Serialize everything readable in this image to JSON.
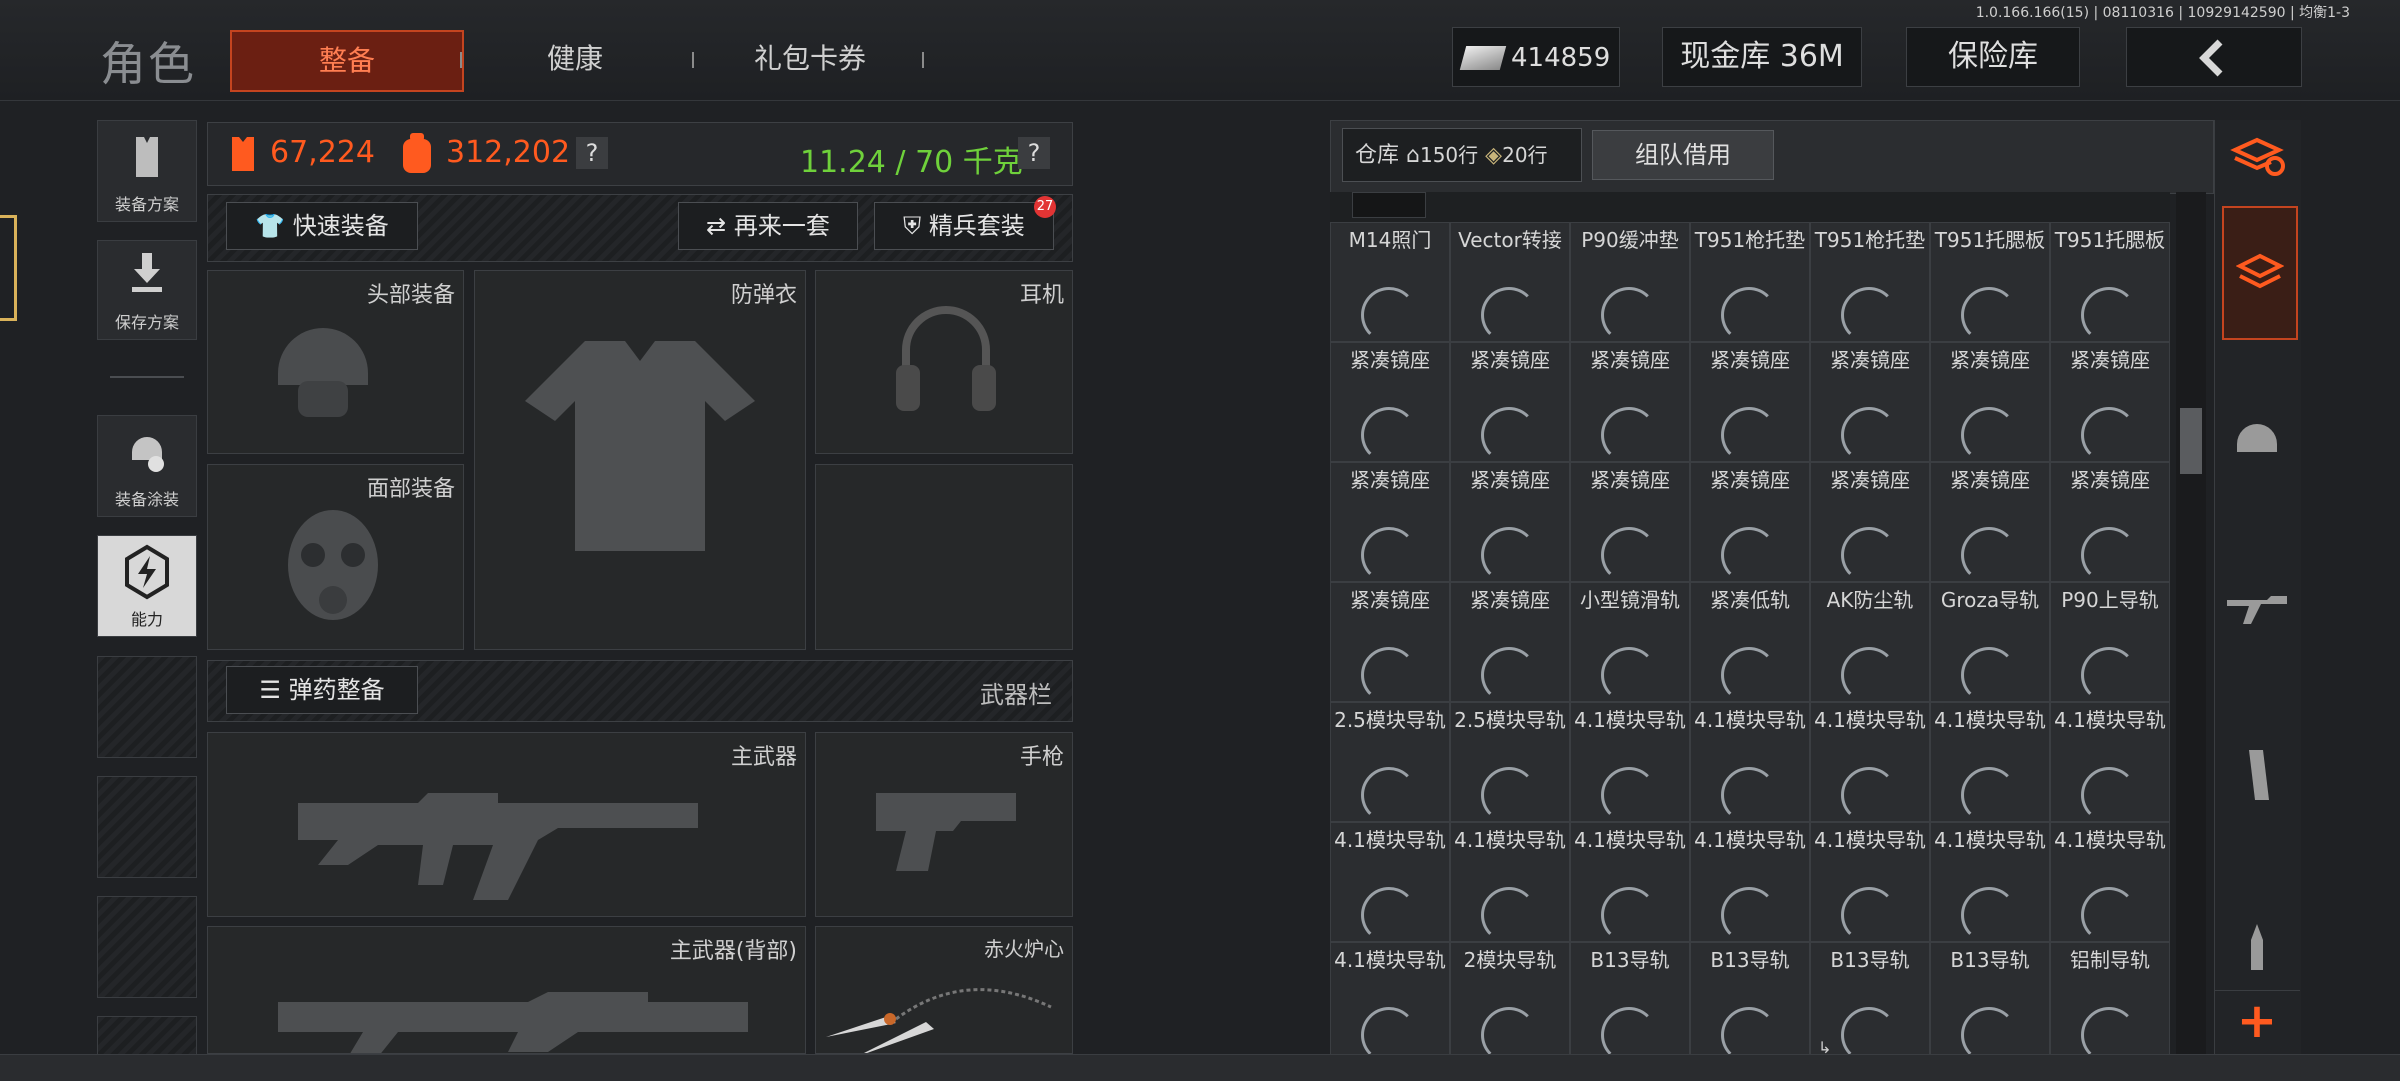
{
  "version": "1.0.166.166(15) | 08110316 | 10929142590 | 均衡1-3",
  "header": {
    "title": "角色",
    "tabs": [
      {
        "label": "整备",
        "active": true
      },
      {
        "label": "健康"
      },
      {
        "label": "礼包卡券"
      }
    ],
    "money": "414859",
    "cash_vault": "现金库 36M",
    "insurance": "保险库",
    "back_icon": "chevron-left-icon"
  },
  "left_sidebar": {
    "items": [
      {
        "label": "装备方案",
        "icon": "vest-icon"
      },
      {
        "label": "保存方案",
        "icon": "download-icon"
      },
      {
        "label": "装备涂装",
        "icon": "helmet-paint-icon"
      },
      {
        "label": "能力",
        "icon": "lightning-hex-icon"
      }
    ]
  },
  "stats": {
    "value_a": "67,224",
    "value_b": "312,202",
    "weight": "11.24 / 70 千克",
    "help": "?"
  },
  "actions": {
    "quick_equip": "快速装备",
    "again": "再来一套",
    "elite": "精兵套装",
    "elite_badge": "27"
  },
  "slots": {
    "head": "头部装备",
    "armor": "防弹衣",
    "ear": "耳机",
    "face": "面部装备",
    "ammo_btn": "弹药整备",
    "weapons": "武器栏",
    "primary": "主武器",
    "pistol": "手枪",
    "primary_back": "主武器(背部)",
    "melee": "赤火炉心"
  },
  "warehouse": {
    "label": "仓库",
    "rows": "150行",
    "rows2": "20行",
    "team": "组队借用",
    "grid": [
      [
        "M14照门",
        "Vector转接",
        "P90缓冲垫",
        "T951枪托垫",
        "T951枪托垫",
        "T951托腮板",
        "T951托腮板"
      ],
      [
        "紧凑镜座",
        "紧凑镜座",
        "紧凑镜座",
        "紧凑镜座",
        "紧凑镜座",
        "紧凑镜座",
        "紧凑镜座"
      ],
      [
        "紧凑镜座",
        "紧凑镜座",
        "紧凑镜座",
        "紧凑镜座",
        "紧凑镜座",
        "紧凑镜座",
        "紧凑镜座"
      ],
      [
        "紧凑镜座",
        "紧凑镜座",
        "小型镜滑轨",
        "紧凑低轨",
        "AK防尘轨",
        "Groza导轨",
        "P90上导轨"
      ],
      [
        "2.5模块导轨",
        "2.5模块导轨",
        "4.1模块导轨",
        "4.1模块导轨",
        "4.1模块导轨",
        "4.1模块导轨",
        "4.1模块导轨"
      ],
      [
        "4.1模块导轨",
        "4.1模块导轨",
        "4.1模块导轨",
        "4.1模块导轨",
        "4.1模块导轨",
        "4.1模块导轨",
        "4.1模块导轨"
      ],
      [
        "4.1模块导轨",
        "2模块导轨",
        "B13导轨",
        "B13导轨",
        "B13导轨",
        "B13导轨",
        "铝制导轨"
      ]
    ]
  },
  "right_sidebar": {
    "icons": [
      "stack-refresh-icon",
      "stack-active-icon",
      "helmet-icon",
      "rifle-icon",
      "magazine-icon",
      "ammo-icon",
      "plus-icon"
    ]
  },
  "colors": {
    "accent": "#ff5a1f",
    "green": "#6fd13b"
  }
}
